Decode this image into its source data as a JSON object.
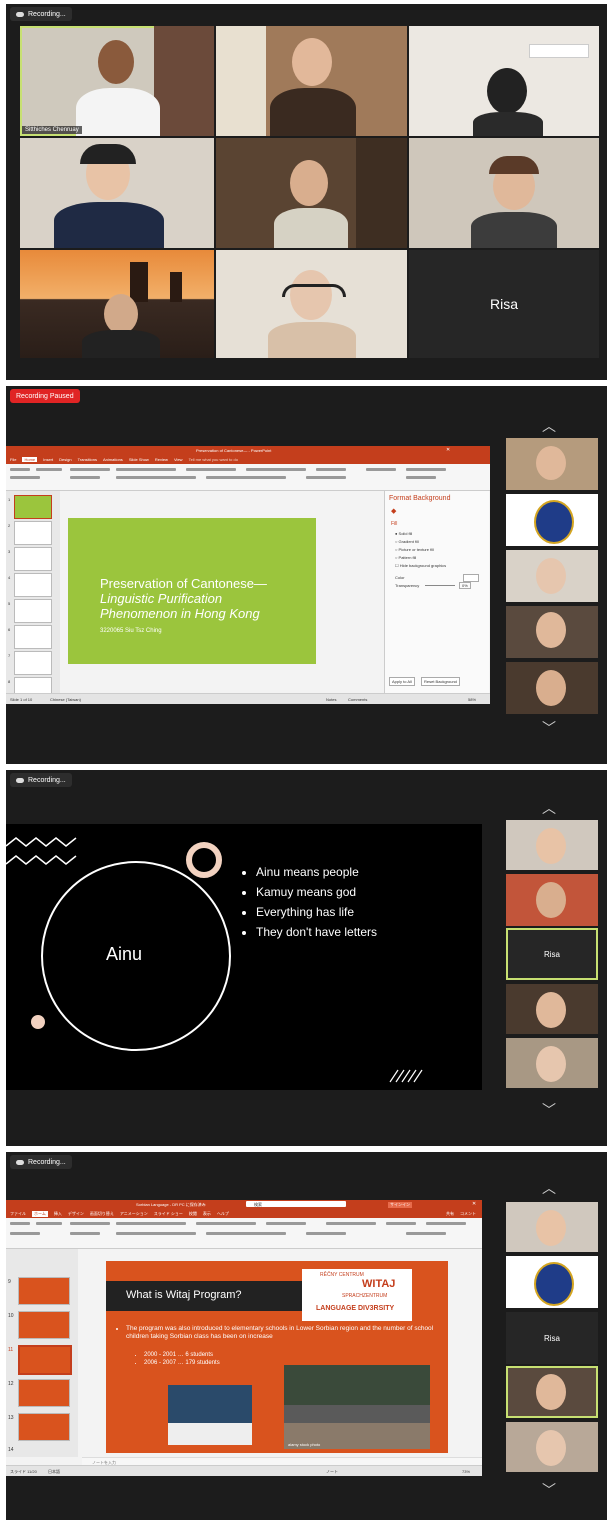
{
  "panel1": {
    "recording_label": "Recording...",
    "speaker_name": "Sitthiches Chenruay",
    "risa_label": "Risa"
  },
  "panel2": {
    "recording_label": "Recording Paused",
    "window_title": "Preservation of Cantonese— - PowerPoint",
    "tabs": [
      "File",
      "Home",
      "Insert",
      "Design",
      "Transitions",
      "Animations",
      "Slide Show",
      "Review",
      "View"
    ],
    "tell_me": "Tell me what you want to do",
    "slide_title_line1": "Preservation of Cantonese—",
    "slide_title_line2": "Linguistic Purification",
    "slide_title_line3": "Phenomenon in Hong Kong",
    "slide_author": "3220065 Siu Tsz Ching",
    "format_pane_title": "Format Background",
    "fill_label": "Fill",
    "fill_options": [
      "Solid fill",
      "Gradient fill",
      "Picture or texture fill",
      "Pattern fill",
      "Hide background graphics"
    ],
    "color_label": "Color",
    "transparency_label": "Transparency",
    "transparency_value": "0%",
    "apply_all": "Apply to All",
    "reset_bg": "Reset Background",
    "status_left": "Slide 1 of 10",
    "status_lang": "Chinese (Taiwan)",
    "status_notes": "Notes",
    "status_comments": "Comments",
    "zoom": "58%",
    "thumb_numbers": [
      "1",
      "2",
      "3",
      "4",
      "5",
      "6",
      "7",
      "8"
    ]
  },
  "panel3": {
    "recording_label": "Recording...",
    "slide_heading": "Ainu",
    "bullets": [
      "Ainu means people",
      "Kamuy means god",
      "Everything has life",
      "They don't have letters"
    ],
    "risa_label": "Risa"
  },
  "panel4": {
    "recording_label": "Recording...",
    "window_title": "Sorbian Language - DR PC に保存済み",
    "search_placeholder": "検索",
    "signin": "サインイン",
    "share": "共有",
    "comment": "コメント",
    "tabs": [
      "ファイル",
      "ホーム",
      "挿入",
      "デザイン",
      "画面切り替え",
      "アニメーション",
      "スライド ショー",
      "校閲",
      "表示",
      "ヘルプ"
    ],
    "slide_title": "What is Witaj Program?",
    "bullet_main": "The program was also introduced to elementary schools in Lower Sorbian region and the number of school children taking Sorbian class has been on increase",
    "sub_bullets": [
      "2000 - 2001 … 6 students",
      "2006 - 2007 … 179 students"
    ],
    "logo_line1": "RĚČNY CENTRUM",
    "logo_line2": "WITAJ",
    "logo_line3": "SPRACHZENTRUM",
    "logo_line4": "LANGUAGE DIV3RSITY",
    "photo_credit": "alamy stock photo",
    "thumb_numbers": [
      "9",
      "10",
      "11",
      "12",
      "13",
      "14"
    ],
    "notes_placeholder": "ノートを入力",
    "status_left": "スライド 11/20",
    "status_lang": "日本語",
    "status_notes": "ノート",
    "zoom": "73%",
    "risa_label": "Risa"
  },
  "colors": {
    "zoom_bg": "#1c1c1c",
    "speaking": "#c7e072",
    "slide_green": "#9bc53d",
    "ppt_red": "#c43e1c",
    "slide_orange": "#d9531e"
  }
}
